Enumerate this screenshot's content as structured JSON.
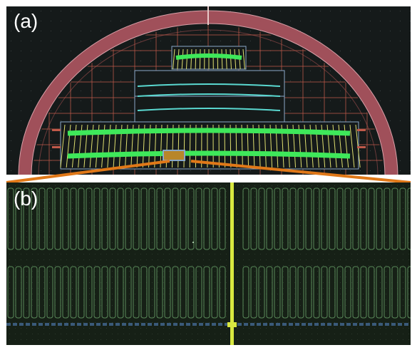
{
  "panels": {
    "a": {
      "label": "(a)"
    },
    "b": {
      "label": "(b)"
    }
  },
  "colors": {
    "background_a": "#151a1a",
    "background_b": "#162016",
    "ring": "#a0505a",
    "grid": "#c05a4a",
    "green_strip": "#3ee85a",
    "yellow_lines": "#e0e070",
    "cyan_lines": "#5ad8d0",
    "highlight_orange": "#e07818",
    "cell_outline": "#5a8a5a",
    "bus_line": "#d8e840",
    "bottom_rail": "#3a5a7a"
  }
}
